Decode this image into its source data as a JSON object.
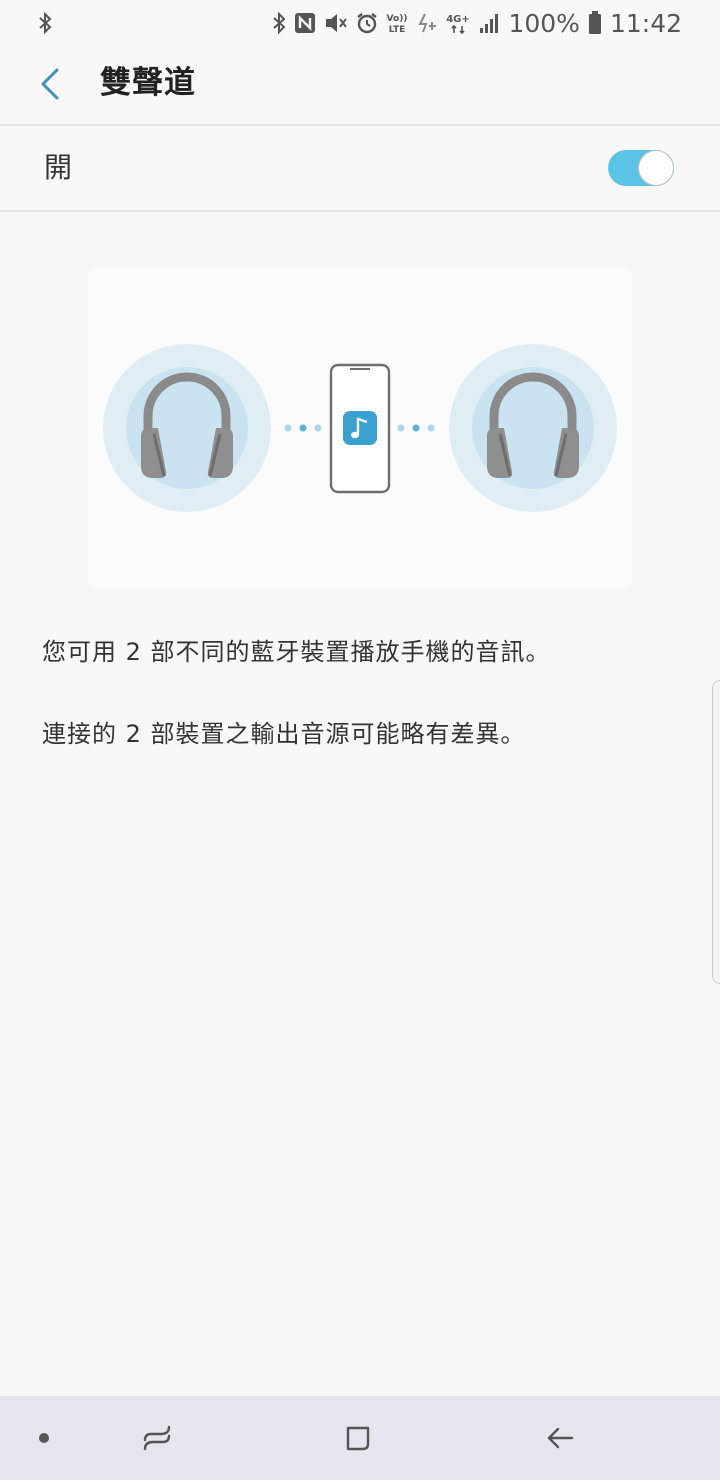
{
  "status_bar": {
    "icons_left": [
      "bluetooth-icon"
    ],
    "icons_right": [
      "bluetooth-icon",
      "nfc-icon",
      "vibrate-icon",
      "alarm-icon",
      "volte-icon",
      "data-saver-icon",
      "4g-plus-icon",
      "signal-icon"
    ],
    "battery": "100%",
    "time": "11:42"
  },
  "header": {
    "title": "雙聲道",
    "back_icon": "chevron-left-icon"
  },
  "toggle": {
    "label": "開",
    "state": "on"
  },
  "illustration": {
    "left_icon": "headphones-icon",
    "center_icon": "phone-music-icon",
    "right_icon": "headphones-icon"
  },
  "description": {
    "line1": "您可用 2 部不同的藍牙裝置播放手機的音訊。",
    "line2": "連接的 2 部裝置之輸出音源可能略有差異。"
  },
  "nav_bar": {
    "icons": [
      "dot-icon",
      "recent-apps-icon",
      "home-icon",
      "back-arrow-icon"
    ]
  },
  "colors": {
    "accent": "#5bc4e6",
    "back_arrow": "#3b8fb8",
    "headphone_glow": "#c9e4f0",
    "background": "#f8f8f8",
    "nav_bar": "#e6e6ee"
  }
}
